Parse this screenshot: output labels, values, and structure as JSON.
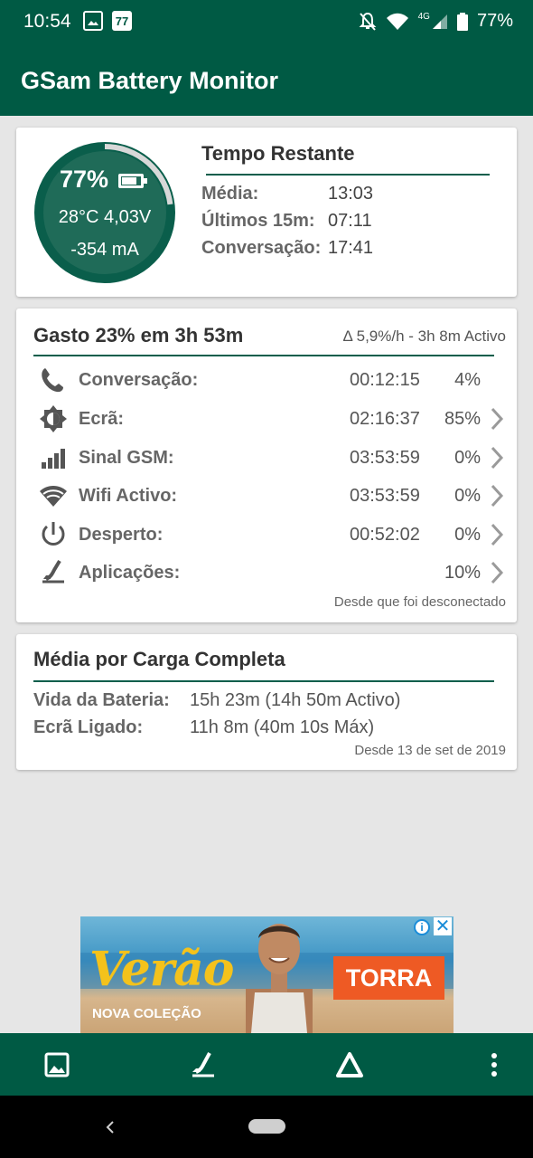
{
  "status_bar": {
    "time": "10:54",
    "notif_icons": [
      "image-icon",
      "77-app-icon"
    ],
    "notif_77_label": "77",
    "network_label": "4G",
    "battery_pct": "77%"
  },
  "app_bar": {
    "title": "GSam Battery Monitor"
  },
  "gauge": {
    "percent_label": "77%",
    "level": 0.77,
    "temp_voltage": "28°C  4,03V",
    "current": "-354 mA",
    "ring_color": "#0a5e4b",
    "fill_color": "#1f6b58"
  },
  "tempo_restante": {
    "title": "Tempo Restante",
    "rows": [
      {
        "label": "Média:",
        "value": "13:03"
      },
      {
        "label": "Últimos 15m:",
        "value": "07:11"
      },
      {
        "label": "Conversação:",
        "value": "17:41"
      }
    ]
  },
  "gasto": {
    "title": "Gasto 23% em 3h 53m",
    "rate": "Δ 5,9%/h - 3h 8m Activo",
    "rows": [
      {
        "icon": "phone-icon",
        "label": "Conversação:",
        "time": "00:12:15",
        "percent": "4%",
        "chevron": false
      },
      {
        "icon": "screen-brightness-icon",
        "label": "Ecrã:",
        "time": "02:16:37",
        "percent": "85%",
        "chevron": true
      },
      {
        "icon": "signal-bars-icon",
        "label": "Sinal GSM:",
        "time": "03:53:59",
        "percent": "0%",
        "chevron": true
      },
      {
        "icon": "wifi-icon",
        "label": "Wifi Activo:",
        "time": "03:53:59",
        "percent": "0%",
        "chevron": true
      },
      {
        "icon": "power-icon",
        "label": "Desperto:",
        "time": "00:52:02",
        "percent": "0%",
        "chevron": true
      },
      {
        "icon": "app-chart-icon",
        "label": "Aplicações:",
        "time": "",
        "percent": "10%",
        "chevron": true
      }
    ],
    "footer": "Desde que foi desconectado"
  },
  "media_carga": {
    "title": "Média por Carga Completa",
    "rows": [
      {
        "label": "Vida da Bateria:",
        "value": "15h 23m (14h 50m Activo)"
      },
      {
        "label": "Ecrã Ligado:",
        "value": "11h 8m (40m 10s Máx)"
      }
    ],
    "footer": "Desde 13 de set de 2019"
  },
  "ad": {
    "headline": "Verão",
    "subline": "NOVA COLEÇÃO",
    "brand": "TORRA",
    "info_icon": "info-icon",
    "close_icon": "close-icon"
  },
  "bottom_toolbar": {
    "buttons": [
      "image-icon",
      "app-chart-icon",
      "delta-icon",
      "more-vert-icon"
    ]
  },
  "nav_bar": {
    "buttons": [
      "back-icon",
      "home-pill"
    ]
  },
  "colors": {
    "primary": "#005a44",
    "accent_line": "#0a5e4b",
    "text_gray": "#666666"
  }
}
